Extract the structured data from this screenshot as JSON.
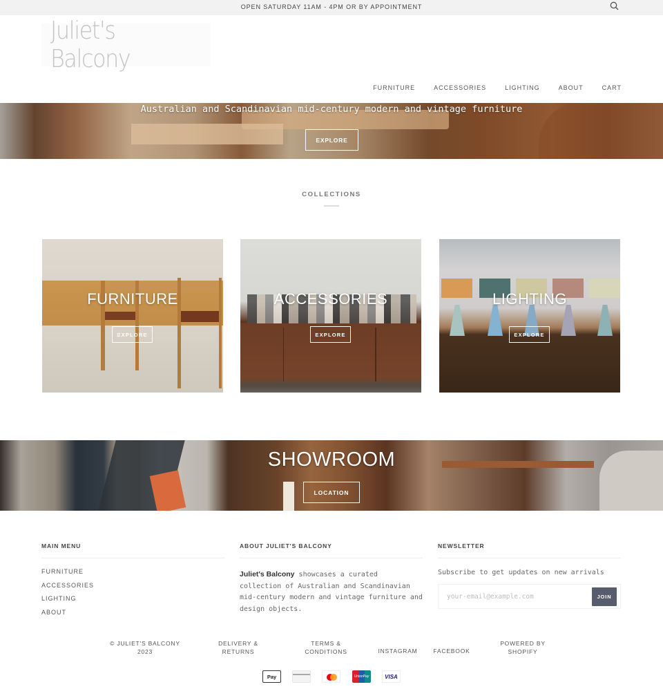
{
  "announcement": {
    "text": "OPEN SATURDAY 11AM - 4PM OR BY APPOINTMENT",
    "search_icon": "search-icon"
  },
  "header": {
    "logo_text": "Juliet's Balcony",
    "nav": [
      "FURNITURE",
      "ACCESSORIES",
      "LIGHTING",
      "ABOUT",
      "CART"
    ]
  },
  "hero": {
    "title": "Australian and Scandinavian mid-century modern and vintage furniture",
    "button_label": "EXPLORE"
  },
  "collections": {
    "heading": "COLLECTIONS",
    "items": [
      {
        "title": "FURNITURE",
        "button_label": "EXPLORE"
      },
      {
        "title": "ACCESSORIES",
        "button_label": "EXPLORE"
      },
      {
        "title": "LIGHTING",
        "button_label": "EXPLORE"
      }
    ]
  },
  "showroom": {
    "title": "SHOWROOM",
    "button_label": "LOCATION"
  },
  "footer": {
    "main_menu": {
      "heading": "MAIN MENU",
      "items": [
        "FURNITURE",
        "ACCESSORIES",
        "LIGHTING",
        "ABOUT"
      ]
    },
    "about": {
      "heading": "ABOUT JULIET'S BALCONY",
      "brand": "Juliet's Balcony",
      "text": " showcases a curated collection of Australian and Scandinavian mid-century modern and vintage furniture and design objects."
    },
    "newsletter": {
      "heading": "NEWSLETTER",
      "text": "Subscribe to get updates on new arrivals",
      "input_value": "",
      "input_placeholder": "your-email@example.com",
      "button_label": "JOIN"
    },
    "legal": {
      "copyright_line1": "© JULIET'S BALCONY",
      "copyright_line2": "2023",
      "delivery_line1": "DELIVERY &",
      "delivery_line2": "RETURNS",
      "terms_line1": "TERMS &",
      "terms_line2": "CONDITIONS",
      "instagram": "INSTAGRAM",
      "facebook": "FACEBOOK",
      "powered_line1": "POWERED BY",
      "powered_line2": "SHOPIFY"
    },
    "payments": {
      "apple_pay": "Pay",
      "apple_pay_fallback": "Pay",
      "unionpay": "UnionPay",
      "visa": "VISA",
      "methods": [
        "apple-pay",
        "generic-card",
        "mastercard",
        "unionpay",
        "visa"
      ]
    }
  }
}
